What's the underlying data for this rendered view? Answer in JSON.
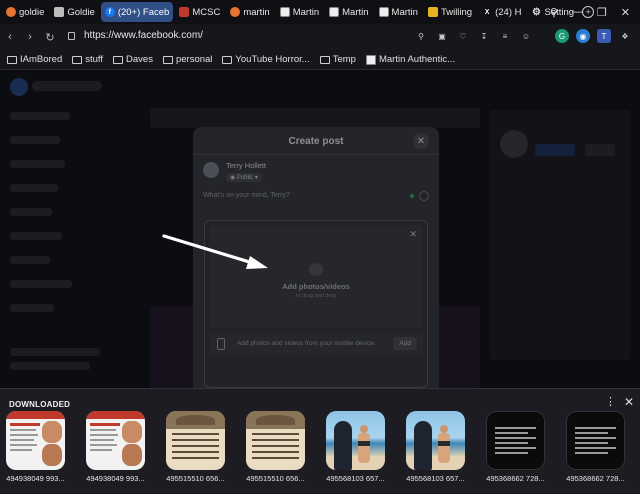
{
  "tabs": [
    {
      "label": "goldie",
      "icon": "orange-circle-icon",
      "color": "#e8732f"
    },
    {
      "label": "Goldie",
      "icon": "w-logo-icon",
      "color": "#bdbdbd"
    },
    {
      "label": "(20+) Faceb",
      "icon": "facebook-icon",
      "color": "#1877f2",
      "active": true
    },
    {
      "label": "MCSC",
      "icon": "red-square-icon",
      "color": "#c0392b"
    },
    {
      "label": "martin",
      "icon": "orange-circle-icon",
      "color": "#e8732f"
    },
    {
      "label": "Martin",
      "icon": "bookmark-page-icon",
      "color": "#e0e0e0"
    },
    {
      "label": "Martin",
      "icon": "bookmark-page-icon",
      "color": "#e0e0e0"
    },
    {
      "label": "Martin",
      "icon": "bookmark-page-icon",
      "color": "#e0e0e0"
    },
    {
      "label": "Twilling",
      "icon": "yellow-square-icon",
      "color": "#e6b422"
    },
    {
      "label": "(24) H",
      "icon": "x-logo-icon",
      "color": "#ffffff"
    },
    {
      "label": "Setting",
      "icon": "gear-icon",
      "color": "#dddddd"
    }
  ],
  "address": {
    "url": "https://www.facebook.com/"
  },
  "bookmarks": [
    {
      "label": "IAmBored",
      "icon": "folder-icon"
    },
    {
      "label": "stuff",
      "icon": "folder-icon"
    },
    {
      "label": "Daves",
      "icon": "folder-icon"
    },
    {
      "label": "personal",
      "icon": "folder-icon"
    },
    {
      "label": "YouTube Horror...",
      "icon": "folder-icon"
    },
    {
      "label": "Temp",
      "icon": "folder-icon"
    },
    {
      "label": "Martin Authentic...",
      "icon": "bookmark-page-icon"
    }
  ],
  "modal": {
    "title": "Create post",
    "user_name": "Terry Hollett",
    "privacy": "Public",
    "placeholder": "What's on your mind, Terry?",
    "dropzone_title": "Add photos/videos",
    "dropzone_sub": "or drag and drop",
    "mobile_text": "Add photos and videos from your mobile device.",
    "add_label": "Add"
  },
  "downloads": {
    "title": "DOWNLOADED",
    "items": [
      {
        "name": "494938049 993...",
        "kind": "portrait-card"
      },
      {
        "name": "494938049 993...",
        "kind": "portrait-card"
      },
      {
        "name": "495515510 656...",
        "kind": "note-paper"
      },
      {
        "name": "495515510 656...",
        "kind": "note-paper"
      },
      {
        "name": "495568103 657...",
        "kind": "beach-photo"
      },
      {
        "name": "495568103 657...",
        "kind": "beach-photo"
      },
      {
        "name": "495368662 728...",
        "kind": "dark-text"
      },
      {
        "name": "495368662 728...",
        "kind": "dark-text"
      }
    ]
  }
}
